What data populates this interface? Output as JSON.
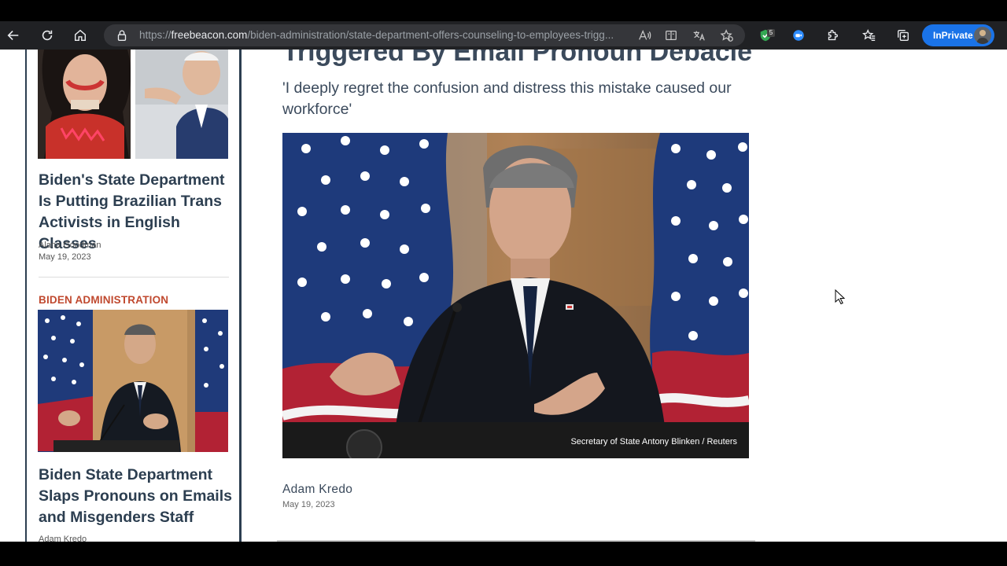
{
  "browser": {
    "url_scheme": "https://",
    "url_host": "freebeacon.com",
    "url_path": "/biden-administration/state-department-offers-counseling-to-employees-trigg...",
    "extension_badge": "5",
    "inprivate_label": "InPrivate"
  },
  "sidebar": {
    "story1": {
      "title": "Biden's State Department Is Putting Brazilian Trans Activists in English Classes",
      "author": "Alana Goodman",
      "date": "May 19, 2023"
    },
    "story2": {
      "category": "BIDEN ADMINISTRATION",
      "title": "Biden State Department Slaps Pronouns on Emails and Misgenders Staff",
      "author": "Adam Kredo"
    }
  },
  "article": {
    "headline": "Triggered By Email Pronoun Debacle",
    "dek": "'I deeply regret the confusion and distress this mistake caused our workforce'",
    "image_caption": "Secretary of State Antony Blinken / Reuters",
    "author": "Adam Kredo",
    "date": "May 19, 2023"
  },
  "colors": {
    "navy": "#2c3e50",
    "category_red": "#c0492f",
    "inprivate_blue": "#1a73e8"
  }
}
